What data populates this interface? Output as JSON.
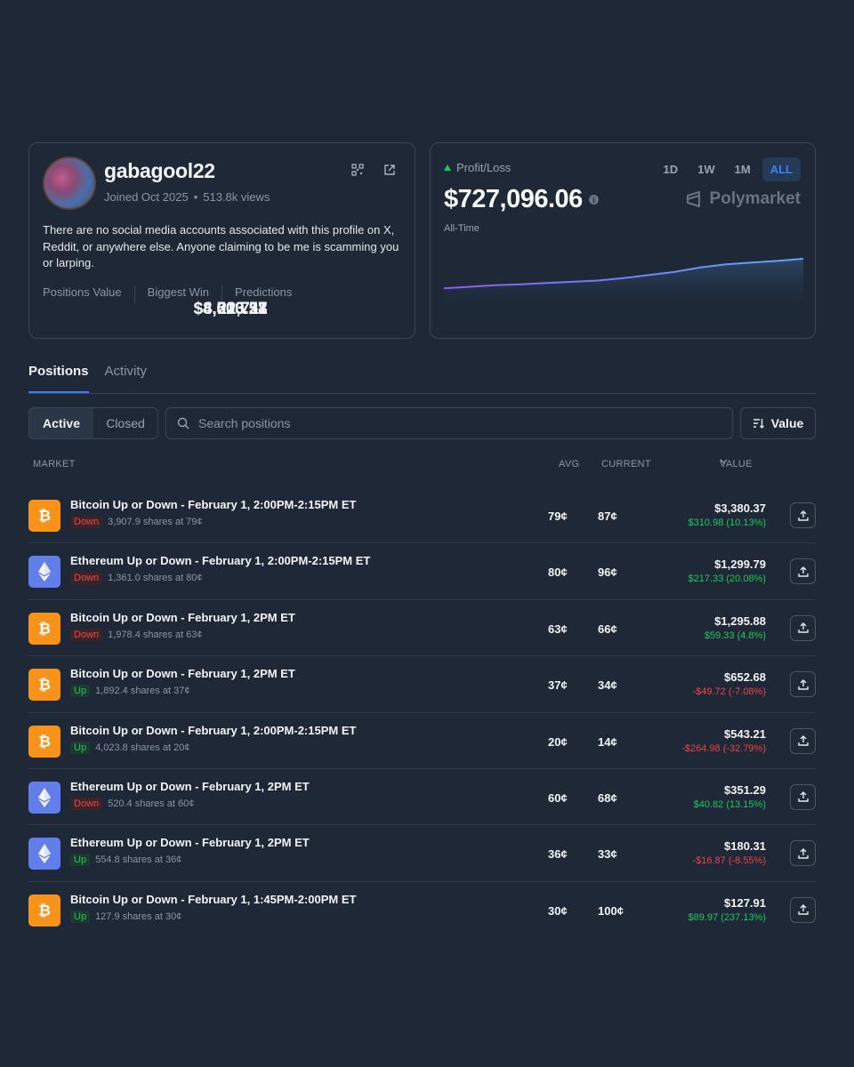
{
  "profile": {
    "username": "gabagool22",
    "joined": "Joined Oct 2025",
    "views": "513.8k views",
    "bio": "There are no social media accounts associated with this profile on X, Reddit, or anywhere else. Anyone claiming to be me is scamming you or larping.",
    "stats": [
      {
        "label": "Positions Value",
        "value": "$8,010.58"
      },
      {
        "label": "Biggest Win",
        "value": "$4,503.27"
      },
      {
        "label": "Predictions",
        "value": "22,711"
      }
    ]
  },
  "pnl": {
    "label": "Profit/Loss",
    "value": "$727,096.06",
    "period": "All-Time",
    "ranges": [
      "1D",
      "1W",
      "1M",
      "ALL"
    ],
    "active_range": "ALL",
    "brand": "Polymarket",
    "series": [
      0.05,
      0.1,
      0.15,
      0.18,
      0.22,
      0.26,
      0.3,
      0.38,
      0.48,
      0.58,
      0.72,
      0.82,
      0.88,
      0.93,
      1.0
    ]
  },
  "tabs": [
    "Positions",
    "Activity"
  ],
  "active_tab": "Positions",
  "filters": {
    "active": "Active",
    "closed": "Closed",
    "search_placeholder": "Search positions",
    "sort_label": "Value"
  },
  "columns": {
    "market": "MARKET",
    "avg": "AVG",
    "current": "CURRENT",
    "value": "VALUE"
  },
  "positions": [
    {
      "coin": "btc",
      "title": "Bitcoin Up or Down - February 1, 2:00PM-2:15PM ET",
      "side": "Down",
      "shares": "3,907.9 shares at 79¢",
      "avg": "79¢",
      "current": "87¢",
      "value": "$3,380.37",
      "pnl": "$310.98 (10.13%)",
      "pnl_sign": "pos"
    },
    {
      "coin": "eth",
      "title": "Ethereum Up or Down - February 1, 2:00PM-2:15PM ET",
      "side": "Down",
      "shares": "1,361.0 shares at 80¢",
      "avg": "80¢",
      "current": "96¢",
      "value": "$1,299.79",
      "pnl": "$217.33 (20.08%)",
      "pnl_sign": "pos"
    },
    {
      "coin": "btc",
      "title": "Bitcoin Up or Down - February 1, 2PM ET",
      "side": "Down",
      "shares": "1,978.4 shares at 63¢",
      "avg": "63¢",
      "current": "66¢",
      "value": "$1,295.88",
      "pnl": "$59.33 (4.8%)",
      "pnl_sign": "pos"
    },
    {
      "coin": "btc",
      "title": "Bitcoin Up or Down - February 1, 2PM ET",
      "side": "Up",
      "shares": "1,892.4 shares at 37¢",
      "avg": "37¢",
      "current": "34¢",
      "value": "$652.68",
      "pnl": "-$49.72 (-7.08%)",
      "pnl_sign": "neg"
    },
    {
      "coin": "btc",
      "title": "Bitcoin Up or Down - February 1, 2:00PM-2:15PM ET",
      "side": "Up",
      "shares": "4,023.8 shares at 20¢",
      "avg": "20¢",
      "current": "14¢",
      "value": "$543.21",
      "pnl": "-$264.98 (-32.79%)",
      "pnl_sign": "neg"
    },
    {
      "coin": "eth",
      "title": "Ethereum Up or Down - February 1, 2PM ET",
      "side": "Down",
      "shares": "520.4 shares at 60¢",
      "avg": "60¢",
      "current": "68¢",
      "value": "$351.29",
      "pnl": "$40.82 (13.15%)",
      "pnl_sign": "pos"
    },
    {
      "coin": "eth",
      "title": "Ethereum Up or Down - February 1, 2PM ET",
      "side": "Up",
      "shares": "554.8 shares at 36¢",
      "avg": "36¢",
      "current": "33¢",
      "value": "$180.31",
      "pnl": "-$16.87 (-8.55%)",
      "pnl_sign": "neg"
    },
    {
      "coin": "btc",
      "title": "Bitcoin Up or Down - February 1, 1:45PM-2:00PM ET",
      "side": "Up",
      "shares": "127.9 shares at 30¢",
      "avg": "30¢",
      "current": "100¢",
      "value": "$127.91",
      "pnl": "$89.97 (237.13%)",
      "pnl_sign": "pos"
    }
  ],
  "colors": {
    "background": "#1e2836",
    "accent": "#3b82f6",
    "positive": "#22c55e",
    "negative": "#ef4444",
    "btc": "#f7931a",
    "eth": "#627eea"
  }
}
